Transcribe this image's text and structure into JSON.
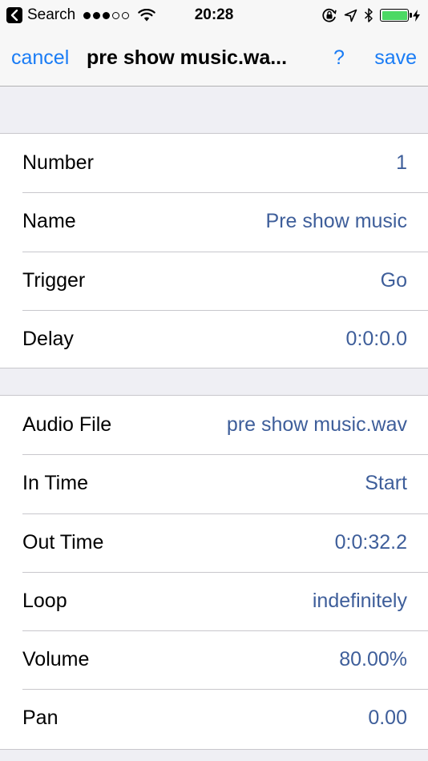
{
  "status_bar": {
    "back_label": "Search",
    "time": "20:28",
    "battery_level": 1.0,
    "signal_bars": 3,
    "signal_total": 5,
    "colors": {
      "battery": "#4cd964"
    }
  },
  "nav": {
    "cancel_label": "cancel",
    "title": "pre show music.wa...",
    "help_label": "?",
    "save_label": "save",
    "accent_color": "#1a7cf5"
  },
  "sections": [
    {
      "rows": [
        {
          "label": "Number",
          "value": "1"
        },
        {
          "label": "Name",
          "value": "Pre show music"
        },
        {
          "label": "Trigger",
          "value": "Go"
        },
        {
          "label": "Delay",
          "value": "0:0:0.0"
        }
      ]
    },
    {
      "rows": [
        {
          "label": "Audio File",
          "value": "pre show music.wav"
        },
        {
          "label": "In Time",
          "value": "Start"
        },
        {
          "label": "Out Time",
          "value": "0:0:32.2"
        },
        {
          "label": "Loop",
          "value": "indefinitely"
        },
        {
          "label": "Volume",
          "value": "80.00%"
        },
        {
          "label": "Pan",
          "value": "0.00"
        }
      ]
    }
  ],
  "value_color": "#3e5e9a"
}
